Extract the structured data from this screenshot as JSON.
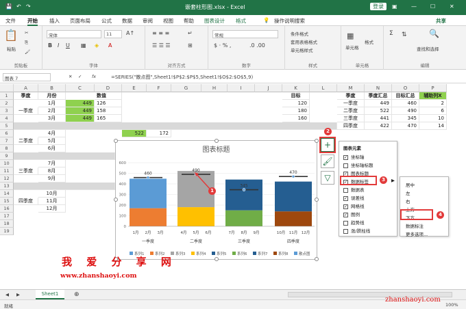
{
  "title_bar": {
    "filename": "嵌套柱形图.xlsx - Excel",
    "login": "登录"
  },
  "menu": {
    "file": "文件",
    "home": "开始",
    "insert": "插入",
    "layout": "页面布局",
    "formulas": "公式",
    "data": "数据",
    "review": "审阅",
    "view": "视图",
    "help": "帮助",
    "chart_design": "图表设计",
    "format": "格式",
    "tell": "操作说明搜索",
    "share": "共享"
  },
  "ribbon": {
    "paste": "粘贴",
    "clipboard": "剪贴板",
    "font_group": "字体",
    "font_name": "宋体",
    "font_size": "11",
    "align_group": "对齐方式",
    "number_group": "数字",
    "number_format": "常规",
    "cond_format": "条件格式",
    "table_format": "套用表格格式",
    "cell_style": "单元格样式",
    "styles_group": "样式",
    "cells_btn": "单元格",
    "cells_group": "单元格",
    "format_btn": "格式",
    "find_select": "查找和选择",
    "edit_group": "编辑"
  },
  "formula_bar": {
    "name_box": "图表 7",
    "fx": "fx",
    "formula": "=SERIES(\"散点图\",Sheet1!$P$2:$P$5,Sheet1!$O$2:$O$5,9)"
  },
  "columns": [
    "A",
    "B",
    "C",
    "D",
    "E",
    "F",
    "G",
    "H",
    "I",
    "J",
    "K",
    "L",
    "M",
    "N",
    "O",
    "P"
  ],
  "rows": [
    "1",
    "2",
    "3",
    "4",
    "5",
    "6",
    "7",
    "8",
    "9",
    "10",
    "11",
    "12",
    "13",
    "14",
    "15",
    "16",
    "17",
    "18",
    "19"
  ],
  "cells": {
    "a1": "季度",
    "b1": "月份",
    "d1": "数值",
    "k1": "目标",
    "a3": "一季度",
    "b2": "1月",
    "b3": "2月",
    "b4": "3月",
    "c2": "449",
    "c3": "449",
    "c4": "449",
    "d2": "126",
    "d3": "158",
    "d4": "165",
    "k2": "120",
    "k3": "180",
    "k4": "160",
    "a7": "二季度",
    "b6": "4月",
    "b7": "5月",
    "b8": "6月",
    "e6": "522",
    "f6": "172",
    "a11": "三季度",
    "b10": "7月",
    "b11": "8月",
    "b12": "9月",
    "a15": "四季度",
    "b14": "10月",
    "b15": "11月",
    "b16": "12月"
  },
  "summary_table": {
    "headers": [
      "季度",
      "季度汇总",
      "目标汇总",
      "辅助列X"
    ],
    "rows": [
      [
        "一季度",
        "449",
        "460",
        "2"
      ],
      [
        "二季度",
        "522",
        "490",
        "6"
      ],
      [
        "三季度",
        "441",
        "345",
        "10"
      ],
      [
        "四季度",
        "422",
        "470",
        "14"
      ]
    ]
  },
  "chart": {
    "title": "图表标题",
    "y_ticks": [
      "600",
      "500",
      "400",
      "300",
      "200",
      "100",
      "0"
    ],
    "totals": [
      "460",
      "490",
      "345",
      "470"
    ],
    "x_months": [
      "1月",
      "2月",
      "3月",
      "4月",
      "5月",
      "6月",
      "7月",
      "8月",
      "9月",
      "10月",
      "11月",
      "12月"
    ],
    "x_quarters": [
      "一季度",
      "二季度",
      "三季度",
      "四季度"
    ],
    "legend": [
      "系列1",
      "系列2",
      "系列3",
      "系列4",
      "系列5",
      "系列6",
      "系列7",
      "系列8",
      "散点图"
    ]
  },
  "chart_elements": {
    "header": "图表元素",
    "items": [
      {
        "label": "坐标轴",
        "checked": true
      },
      {
        "label": "坐标轴标题",
        "checked": false
      },
      {
        "label": "图表标题",
        "checked": true
      },
      {
        "label": "数据标签",
        "checked": true
      },
      {
        "label": "数据表",
        "checked": false
      },
      {
        "label": "误差线",
        "checked": true
      },
      {
        "label": "网格线",
        "checked": true
      },
      {
        "label": "图例",
        "checked": true
      },
      {
        "label": "趋势线",
        "checked": false
      },
      {
        "label": "涨/跌柱线",
        "checked": false
      }
    ]
  },
  "label_submenu": [
    "居中",
    "左",
    "右",
    "上方",
    "下方",
    "数据标注",
    "更多选项..."
  ],
  "badges": [
    "1",
    "2",
    "3",
    "4"
  ],
  "watermark": {
    "text": "我 爱 分 享 网",
    "url": "www.zhanshaoyi.com",
    "url2": "zhanshaoyi.com"
  },
  "sheet_tab": "Sheet1",
  "status": {
    "ready": "就绪",
    "zoom": "100%"
  },
  "colors": {
    "excel_green": "#217346",
    "orange": "#ed7d31",
    "gray": "#a5a5a5",
    "yellow": "#ffc000",
    "blue": "#5b9bd5",
    "green": "#70ad47",
    "navy": "#255e91",
    "brown": "#9e480e",
    "red": "#e23a3a"
  }
}
